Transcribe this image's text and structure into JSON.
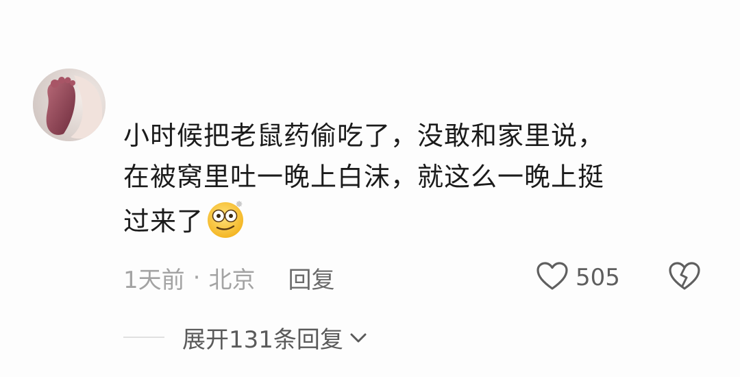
{
  "comment": {
    "avatar_icon": "avatar-baby-foot",
    "text_lines": [
      "小时候把老鼠药偷吃了，没敢和家里说，",
      "在被窝里吐一晚上白沫，就这么一晚上挺",
      "过来了"
    ],
    "emoji_icon": "dizzy-face-emoji",
    "time": "1天前",
    "separator": "·",
    "location": "北京",
    "reply_label": "回复",
    "like_icon": "heart-outline-icon",
    "like_count": "505",
    "dislike_icon": "broken-heart-icon"
  },
  "replies": {
    "expand_label": "展开131条回复",
    "expand_icon": "chevron-down-icon"
  }
}
